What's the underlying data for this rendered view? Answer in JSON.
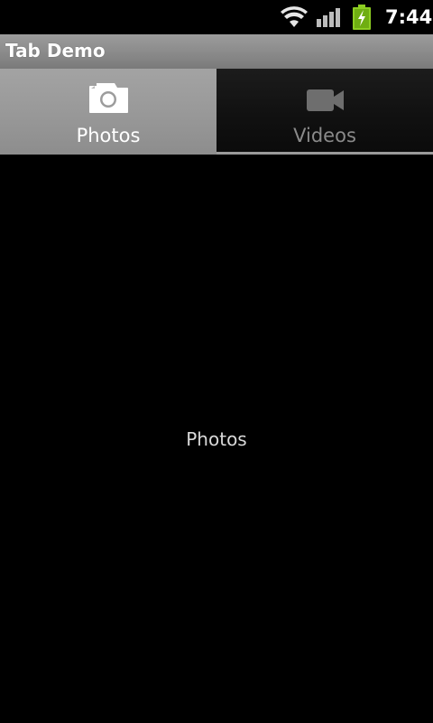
{
  "status_bar": {
    "time": "7:44",
    "icons": [
      "wifi-icon",
      "signal-icon",
      "battery-charging-icon"
    ]
  },
  "app": {
    "title": "Tab Demo"
  },
  "tabs": [
    {
      "label": "Photos",
      "icon": "camera-icon",
      "selected": true
    },
    {
      "label": "Videos",
      "icon": "video-camera-icon",
      "selected": false
    }
  ],
  "content": {
    "text": "Photos"
  },
  "colors": {
    "selected_tab": "#999999",
    "unselected_tab": "#111111",
    "battery": "#8ccd22",
    "background": "#000000"
  }
}
